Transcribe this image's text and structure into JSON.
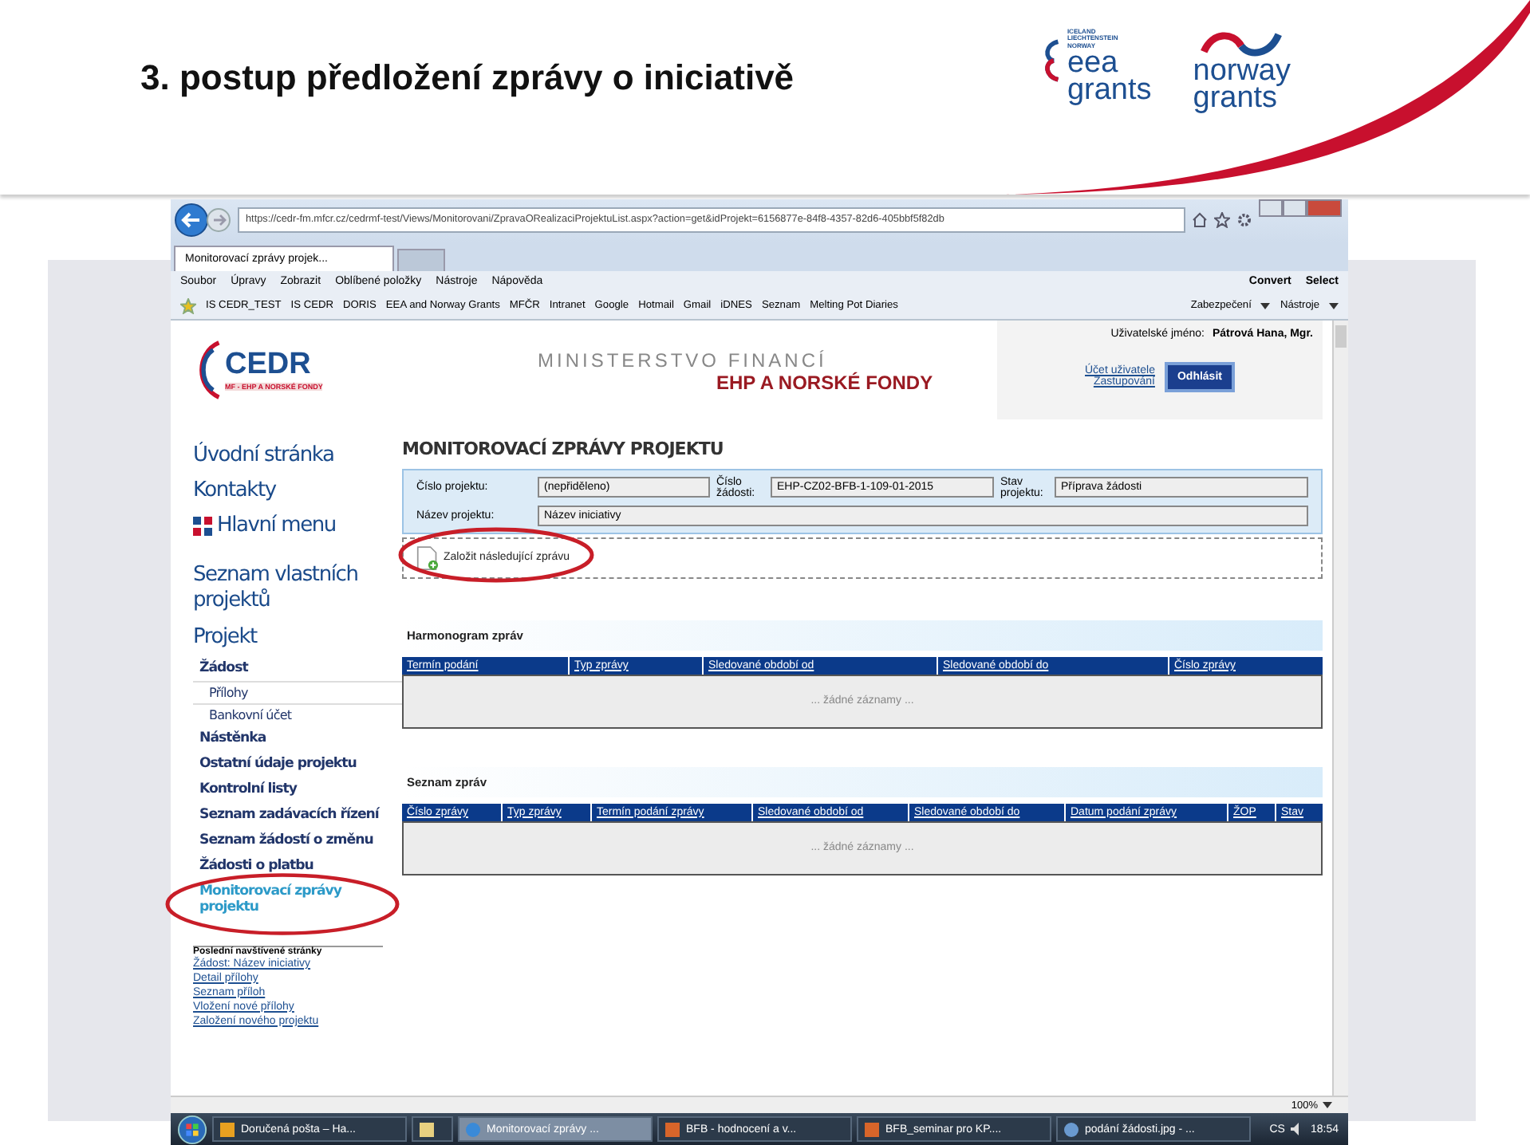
{
  "slide": {
    "title": "3. postup předložení zprávy o iniciativě",
    "logos": [
      {
        "kind": "eea",
        "caption": "ICELAND LIECHTENSTEIN NORWAY",
        "line1": "eea",
        "line2": "grants"
      },
      {
        "kind": "norway",
        "line1": "norway",
        "line2": "grants"
      }
    ]
  },
  "browser": {
    "address": "https://cedr-fm.mfcr.cz/cedrmf-test/Views/Monitorovani/ZpravaORealizaciProjektuList.aspx?action=get&idProjekt=6156877e-84f8-4357-82d6-405bbf5f82db",
    "tab": "Monitorovací zprávy projek...",
    "menu": [
      "Soubor",
      "Úpravy",
      "Zobrazit",
      "Oblíbené položky",
      "Nástroje",
      "Nápověda"
    ],
    "menu_right": [
      "Convert",
      "Select"
    ],
    "favorites": [
      "IS CEDR_TEST",
      "IS CEDR",
      "DORIS",
      "EEA and Norway Grants",
      "MFČR",
      "Intranet",
      "Google",
      "Hotmail",
      "Gmail",
      "iDNES",
      "Seznam",
      "Melting Pot Diaries"
    ],
    "favorites_right": [
      "Zabezpečení",
      "Nástroje"
    ],
    "zoom": "100%"
  },
  "page": {
    "logo": {
      "name": "CEDR",
      "subtitle": "MF - EHP A NORSKÉ FONDY"
    },
    "header": {
      "line1": "MINISTERSTVO FINANCÍ",
      "line2": "EHP A NORSKÉ FONDY"
    },
    "user": {
      "label": "Uživatelské jméno:",
      "name": "Pátrová Hana, Mgr.",
      "links": [
        "Účet uživatele",
        "Zastupování"
      ],
      "logout": "Odhlásit"
    },
    "sidebar": {
      "main_links": [
        {
          "label": "Úvodní stránka",
          "icon": false
        },
        {
          "label": "Kontakty",
          "icon": false
        },
        {
          "label": "Hlavní menu",
          "icon": true
        }
      ],
      "own_projects": "Seznam vlastních projektů",
      "project": {
        "title": "Projekt",
        "items": [
          {
            "label": "Žádost",
            "selected": false,
            "circled": false,
            "children": [
              {
                "label": "Přílohy",
                "selected": false
              },
              {
                "label": "Bankovní účet",
                "selected": false
              }
            ]
          },
          {
            "label": "Nástěnka",
            "selected": false,
            "circled": false
          },
          {
            "label": "Ostatní údaje projektu",
            "selected": false,
            "circled": false
          },
          {
            "label": "Kontrolní listy",
            "selected": false,
            "circled": false
          },
          {
            "label": "Seznam zadávacích řízení",
            "selected": false,
            "circled": false
          },
          {
            "label": "Seznam žádostí o změnu",
            "selected": false,
            "circled": false
          },
          {
            "label": "Žádosti o platbu",
            "selected": false,
            "circled": false
          },
          {
            "label": "Monitorovací zprávy projektu",
            "selected": true,
            "circled": true
          }
        ]
      },
      "recent": {
        "title": "Poslední navštívené stránky",
        "links": [
          "Žádost: Název iniciativy",
          "Detail přílohy",
          "Seznam příloh",
          "Vložení nové přílohy",
          "Založení nového projektu"
        ]
      }
    },
    "main": {
      "title": "MONITOROVACÍ ZPRÁVY PROJEKTU",
      "fields": [
        {
          "label": "Číslo projektu:",
          "value": "(nepřiděleno)"
        },
        {
          "label": "Číslo žádosti:",
          "value": "EHP-CZ02-BFB-1-109-01-2015"
        },
        {
          "label": "Stav projektu:",
          "value": "Příprava žádosti"
        },
        {
          "label": "Název projektu:",
          "value": "Název iniciativy"
        }
      ],
      "action": {
        "label": "Založit následující zprávu",
        "circled": true
      },
      "tables": [
        {
          "title": "Harmonogram zpráv",
          "columns": [
            "Termín podání",
            "Typ zprávy",
            "Sledované období od",
            "Sledované období do",
            "Číslo zprávy"
          ],
          "empty": "... žádné záznamy ..."
        },
        {
          "title": "Seznam zpráv",
          "columns": [
            "Číslo zprávy",
            "Typ zprávy",
            "Termín podání zprávy",
            "Sledované období od",
            "Sledované období do",
            "Datum podání zprávy",
            "ŽOP",
            "Stav"
          ],
          "empty": "... žádné záznamy ..."
        }
      ]
    }
  },
  "taskbar": {
    "items": [
      {
        "label": "Doručená pošta – Ha...",
        "kind": "mail",
        "selected": false
      },
      {
        "kind": "folder",
        "selected": false
      },
      {
        "label": "Monitorovací zprávy ...",
        "kind": "browser",
        "selected": true
      },
      {
        "label": "BFB - hodnocení a v...",
        "kind": "slides",
        "selected": false
      },
      {
        "label": "BFB_seminar pro KP....",
        "kind": "slides",
        "selected": false
      },
      {
        "label": "podání žádosti.jpg - ...",
        "kind": "viewer",
        "selected": false
      }
    ],
    "language": "CS",
    "time": "18:54"
  }
}
